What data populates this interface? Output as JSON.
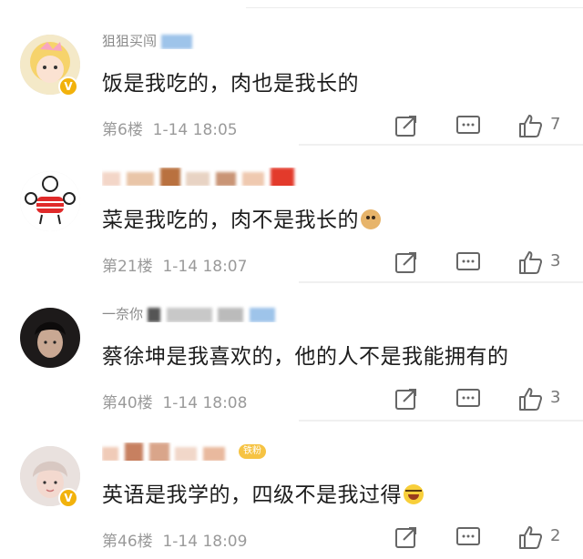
{
  "comments": [
    {
      "avatar": "blonde-cartoon-avatar",
      "verified": true,
      "username_blurred": "狙狙买闯",
      "fan_badge": "",
      "text": "饭是我吃的，肉也是我长的",
      "emoji": "",
      "floor": "第6楼",
      "time": "1-14 18:05",
      "likes": "7"
    },
    {
      "avatar": "muscle-cartoon-avatar",
      "verified": false,
      "username_blurred": "",
      "fan_badge": "",
      "text": "菜是我吃的，肉不是我长的",
      "emoji": "doge",
      "floor": "第21楼",
      "time": "1-14 18:07",
      "likes": "3"
    },
    {
      "avatar": "man-photo-avatar",
      "verified": false,
      "username_blurred": "一奈你",
      "fan_badge": "",
      "text": "蔡徐坤是我喜欢的，他的人不是我能拥有的",
      "emoji": "",
      "floor": "第40楼",
      "time": "1-14 18:08",
      "likes": "3"
    },
    {
      "avatar": "boy-photo-avatar",
      "verified": true,
      "username_blurred": "",
      "fan_badge": "铁粉",
      "text": "英语是我学的，四级不是我过得",
      "emoji": "laugh-cry",
      "floor": "第46楼",
      "time": "1-14 18:09",
      "likes": "2"
    }
  ],
  "icons": {
    "share": "share-icon",
    "comment": "comment-icon",
    "like": "thumbs-up-icon"
  },
  "colors": {
    "text": "#1c1c1c",
    "meta": "#9a9a9a",
    "verified": "#f2b20c",
    "divider": "#f2f2f2"
  }
}
